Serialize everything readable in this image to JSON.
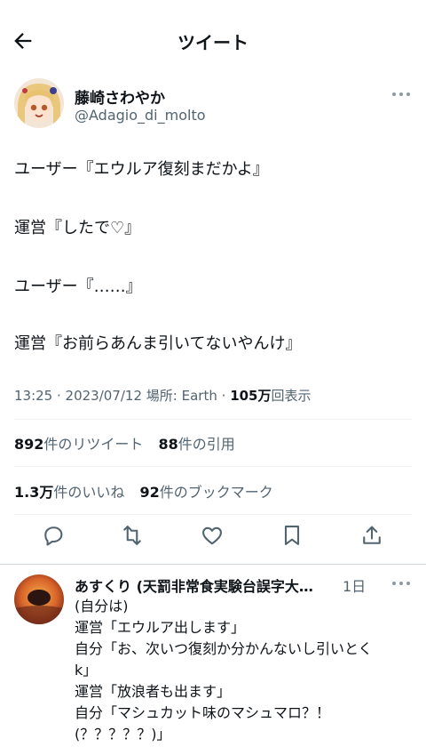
{
  "header": {
    "title": "ツイート"
  },
  "tweet": {
    "display_name": "藤崎さわやか",
    "handle": "@Adagio_di_molto",
    "lines": [
      "ユーザー『エウルア復刻まだかよ』",
      "運営『したで♡』",
      "ユーザー『……』",
      "運営『お前らあんま引いてないやんけ』"
    ],
    "time": "13:25",
    "date": "2023/07/12",
    "location_label": "場所:",
    "location": "Earth",
    "views_num": "105万",
    "views_label": "回表示"
  },
  "stats": {
    "retweets_num": "892",
    "retweets_label": "件のリツイート",
    "quotes_num": "88",
    "quotes_label": "件の引用",
    "likes_num": "1.3万",
    "likes_label": "件のいいね",
    "bookmarks_num": "92",
    "bookmarks_label": "件のブックマーク"
  },
  "actions": [
    "reply-icon",
    "retweet-icon",
    "like-icon",
    "bookmark-icon",
    "share-icon"
  ],
  "reply": {
    "display_name": "あすくり (天罰非常食実験台誤字大…",
    "time": "1日",
    "lines": [
      "(自分は)",
      "運営「エウルア出します」",
      "自分「お、次いつ復刻か分かんないし引いとく",
      "k」",
      "運営「放浪者も出ます」",
      "自分「マシュカット味のマシュマロ？！",
      "(？？？？？)」"
    ]
  },
  "colors": {
    "text": "#0f1419",
    "secondary": "#536471",
    "divider": "#eff3f4"
  }
}
